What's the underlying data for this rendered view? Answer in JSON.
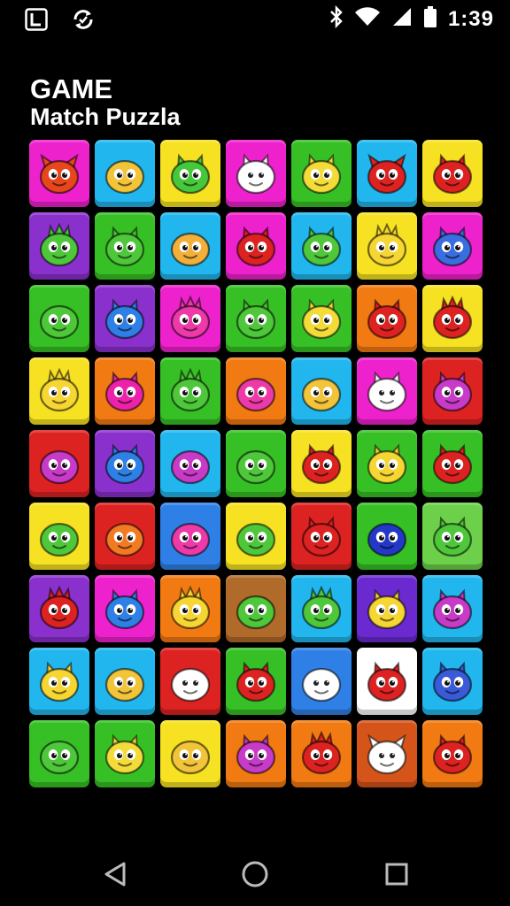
{
  "status_bar": {
    "time": "1:39",
    "left_icons": [
      "app-l-icon",
      "sync-icon"
    ],
    "right_icons": [
      "bluetooth-icon",
      "wifi-icon",
      "signal-icon",
      "battery-icon"
    ]
  },
  "header": {
    "title": "GAME",
    "subtitle": "Match Puzzla"
  },
  "board": {
    "rows": 9,
    "cols": 7,
    "tiles": [
      [
        {
          "bg": "#ee22cc",
          "creature": "#e8461c",
          "kind": "horns"
        },
        {
          "bg": "#21b7ee",
          "creature": "#f2c43a",
          "kind": "blob"
        },
        {
          "bg": "#f6e222",
          "creature": "#46c83a",
          "kind": "ears"
        },
        {
          "bg": "#ee22cc",
          "creature": "#ffffff",
          "kind": "ears"
        },
        {
          "bg": "#36c025",
          "creature": "#f3dc3a",
          "kind": "ears"
        },
        {
          "bg": "#21b7ee",
          "creature": "#dd2222",
          "kind": "horns"
        },
        {
          "bg": "#f6e222",
          "creature": "#dd2222",
          "kind": "ears"
        }
      ],
      [
        {
          "bg": "#8a30cc",
          "creature": "#4ec83a",
          "kind": "spiky"
        },
        {
          "bg": "#36c025",
          "creature": "#4ec83a",
          "kind": "ears"
        },
        {
          "bg": "#21b7ee",
          "creature": "#f2b03a",
          "kind": "blob"
        },
        {
          "bg": "#ee22cc",
          "creature": "#dd2222",
          "kind": "ears"
        },
        {
          "bg": "#21b7ee",
          "creature": "#4ec83a",
          "kind": "ears"
        },
        {
          "bg": "#f6e222",
          "creature": "#f6d632",
          "kind": "spiky"
        },
        {
          "bg": "#ee22cc",
          "creature": "#3a6ee0",
          "kind": "ears"
        }
      ],
      [
        {
          "bg": "#36c025",
          "creature": "#4ec83a",
          "kind": "blob"
        },
        {
          "bg": "#8a30cc",
          "creature": "#2f80e6",
          "kind": "ears"
        },
        {
          "bg": "#ee22cc",
          "creature": "#ee3aa8",
          "kind": "spiky"
        },
        {
          "bg": "#36c025",
          "creature": "#4ec83a",
          "kind": "ears"
        },
        {
          "bg": "#36c025",
          "creature": "#f3dc3a",
          "kind": "ears"
        },
        {
          "bg": "#f27a12",
          "creature": "#dd2222",
          "kind": "ears"
        },
        {
          "bg": "#f6e222",
          "creature": "#dd2222",
          "kind": "spiky"
        }
      ],
      [
        {
          "bg": "#f6e222",
          "creature": "#f6d632",
          "kind": "spiky"
        },
        {
          "bg": "#f27a12",
          "creature": "#ee22aa",
          "kind": "ears"
        },
        {
          "bg": "#36c025",
          "creature": "#4ec83a",
          "kind": "spiky"
        },
        {
          "bg": "#f27a12",
          "creature": "#ee3aa8",
          "kind": "blob"
        },
        {
          "bg": "#21b7ee",
          "creature": "#f2c43a",
          "kind": "blob"
        },
        {
          "bg": "#ee22cc",
          "creature": "#ffffff",
          "kind": "ears"
        },
        {
          "bg": "#dd2222",
          "creature": "#c83ac8",
          "kind": "ears"
        }
      ],
      [
        {
          "bg": "#dd2222",
          "creature": "#c83ac8",
          "kind": "blob"
        },
        {
          "bg": "#8a30cc",
          "creature": "#2f80e6",
          "kind": "ears"
        },
        {
          "bg": "#21b7ee",
          "creature": "#c83ac8",
          "kind": "blob"
        },
        {
          "bg": "#36c025",
          "creature": "#4ec83a",
          "kind": "blob"
        },
        {
          "bg": "#f6e222",
          "creature": "#dd2222",
          "kind": "ears"
        },
        {
          "bg": "#36c025",
          "creature": "#f6d632",
          "kind": "ears"
        },
        {
          "bg": "#36c025",
          "creature": "#dd2222",
          "kind": "ears"
        }
      ],
      [
        {
          "bg": "#f6e222",
          "creature": "#4ec83a",
          "kind": "blob"
        },
        {
          "bg": "#dd2222",
          "creature": "#f27a22",
          "kind": "blob"
        },
        {
          "bg": "#2f80e6",
          "creature": "#ee3aa8",
          "kind": "blob"
        },
        {
          "bg": "#f6e222",
          "creature": "#4ec83a",
          "kind": "blob"
        },
        {
          "bg": "#dd2222",
          "creature": "#dd2222",
          "kind": "ears"
        },
        {
          "bg": "#36c025",
          "creature": "#2438c8",
          "kind": "blob"
        },
        {
          "bg": "#6cd04a",
          "creature": "#4ec83a",
          "kind": "ears"
        }
      ],
      [
        {
          "bg": "#8a30cc",
          "creature": "#dd2222",
          "kind": "spiky"
        },
        {
          "bg": "#ee22cc",
          "creature": "#2f80e6",
          "kind": "ears"
        },
        {
          "bg": "#f27a12",
          "creature": "#f6d632",
          "kind": "spiky"
        },
        {
          "bg": "#b06a2a",
          "creature": "#4ec83a",
          "kind": "blob"
        },
        {
          "bg": "#21b7ee",
          "creature": "#4ec83a",
          "kind": "spiky"
        },
        {
          "bg": "#6a2ad0",
          "creature": "#f6d632",
          "kind": "ears"
        },
        {
          "bg": "#21b7ee",
          "creature": "#c83ac8",
          "kind": "ears"
        }
      ],
      [
        {
          "bg": "#21b7ee",
          "creature": "#f6d632",
          "kind": "ears"
        },
        {
          "bg": "#21b7ee",
          "creature": "#f2c43a",
          "kind": "blob"
        },
        {
          "bg": "#dd2222",
          "creature": "#ffffff",
          "kind": "blob"
        },
        {
          "bg": "#36c025",
          "creature": "#dd2222",
          "kind": "ears"
        },
        {
          "bg": "#2f80e6",
          "creature": "#ffffff",
          "kind": "blob"
        },
        {
          "bg": "#ffffff",
          "creature": "#dd2222",
          "kind": "ears"
        },
        {
          "bg": "#21b7ee",
          "creature": "#3a5ad8",
          "kind": "ears"
        }
      ],
      [
        {
          "bg": "#36c025",
          "creature": "#4ec83a",
          "kind": "blob"
        },
        {
          "bg": "#36c025",
          "creature": "#f3dc3a",
          "kind": "ears"
        },
        {
          "bg": "#f6e222",
          "creature": "#f2c43a",
          "kind": "blob"
        },
        {
          "bg": "#f27a12",
          "creature": "#c83ac8",
          "kind": "ears"
        },
        {
          "bg": "#f27a12",
          "creature": "#dd2222",
          "kind": "spiky"
        },
        {
          "bg": "#d4541a",
          "creature": "#ffffff",
          "kind": "horns"
        },
        {
          "bg": "#f27a12",
          "creature": "#dd2222",
          "kind": "ears"
        }
      ]
    ]
  },
  "nav_bar": {
    "buttons": [
      "back",
      "home",
      "recents"
    ]
  }
}
